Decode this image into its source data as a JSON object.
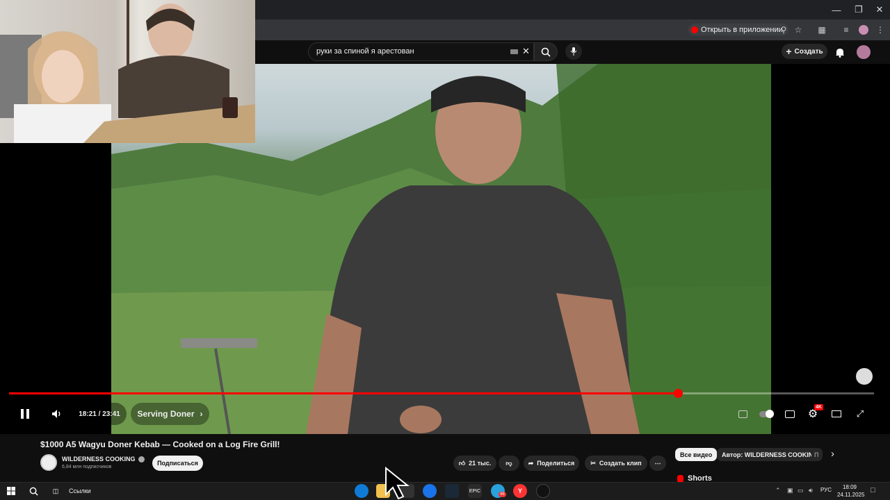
{
  "browser": {
    "open_in_app_label": "Открыть в приложении",
    "window_controls": {
      "minimize": "—",
      "restore": "❐",
      "close": "✕"
    }
  },
  "header": {
    "search_query": "руки за спиной я арестован",
    "create_label": "Создать"
  },
  "player": {
    "time_current": "18:21",
    "time_total": "23:41",
    "time_display": "18:21 / 23:41",
    "progress_fraction": 0.773,
    "chapter_label": "Serving Doner",
    "quality_badge": "4K"
  },
  "video": {
    "title": "$1000 A5 Wagyu Doner Kebab — Cooked on a Log Fire Grill!",
    "channel_name": "WILDERNESS COOKING",
    "subscribers": "6,84 млн подписчиков",
    "subscribe_label": "Подписаться",
    "likes_label": "21 тыс.",
    "share_label": "Поделиться",
    "clip_label": "Создать клип"
  },
  "recommendations": {
    "chips": [
      "Все видео",
      "Автор: WILDERNESS COOKING",
      "П"
    ],
    "shorts_label": "Shorts"
  },
  "taskbar": {
    "links_label": "Ссылки",
    "lang": "РУС",
    "time": "18:09",
    "date": "24.11.2025",
    "telegram_badge": "46"
  },
  "colors": {
    "accent": "#ff0000",
    "background": "#0f0f0f",
    "pill": "#272727"
  }
}
